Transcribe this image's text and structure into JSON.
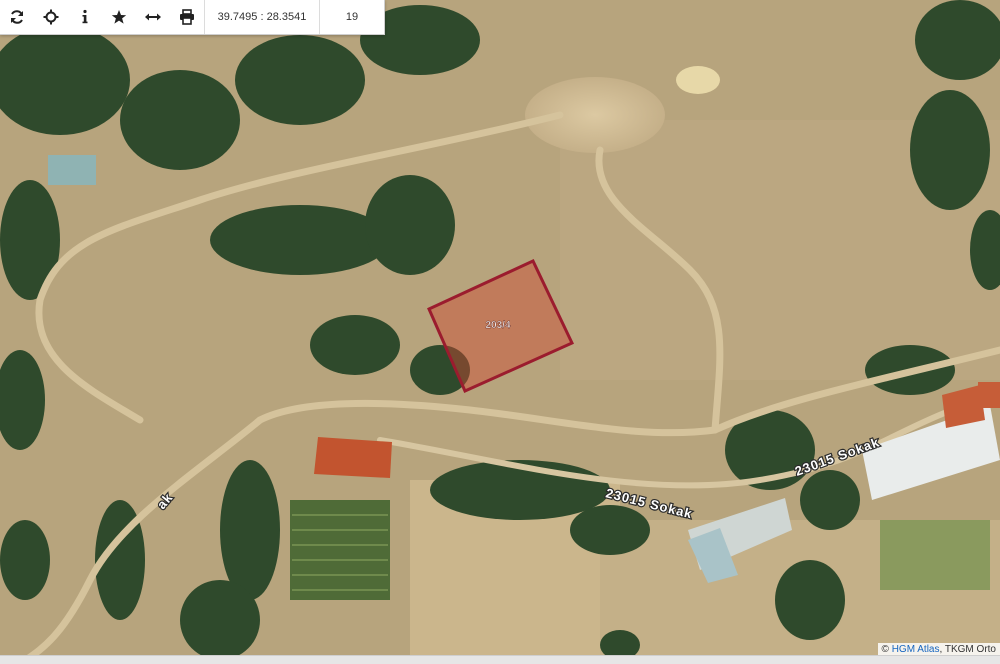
{
  "toolbar": {
    "buttons": [
      {
        "name": "refresh-icon"
      },
      {
        "name": "locate-icon"
      },
      {
        "name": "info-icon"
      },
      {
        "name": "star-icon"
      },
      {
        "name": "measure-icon"
      },
      {
        "name": "print-icon"
      }
    ],
    "coordinates": "39.7495 : 28.3541",
    "zoom_level": "19"
  },
  "map": {
    "parcel_label": "203/4",
    "parcel_color": "#9b1c2e",
    "roads": [
      {
        "label": "23015 Sokak"
      },
      {
        "label": "23015 Sokak"
      },
      {
        "label": "ak"
      }
    ]
  },
  "attribution": {
    "prefix": "© ",
    "link": "HGM Atlas",
    "suffix": ", TKGM Orto"
  }
}
